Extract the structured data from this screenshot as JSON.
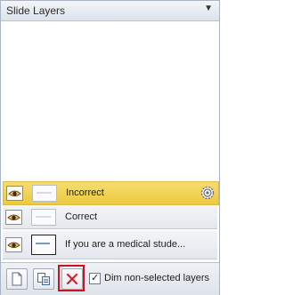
{
  "panel": {
    "title": "Slide Layers",
    "dropdown_icon": "triangle-down-icon"
  },
  "layers": [
    {
      "name": "Incorrect",
      "selected": true,
      "visible": true
    },
    {
      "name": "Correct",
      "selected": false,
      "visible": true
    },
    {
      "name": "If you are a medical stude...",
      "selected": false,
      "visible": true
    }
  ],
  "toolbar": {
    "new_layer_icon": "new-layer-icon",
    "duplicate_layer_icon": "duplicate-layer-icon",
    "delete_layer_icon": "delete-layer-icon",
    "dim_checkbox_checked": true,
    "dim_checkbox_label": "Dim non-selected layers"
  },
  "colors": {
    "selected_row": "#f0d24f",
    "delete_highlight": "#c8141e",
    "delete_x": "#d2232a"
  }
}
